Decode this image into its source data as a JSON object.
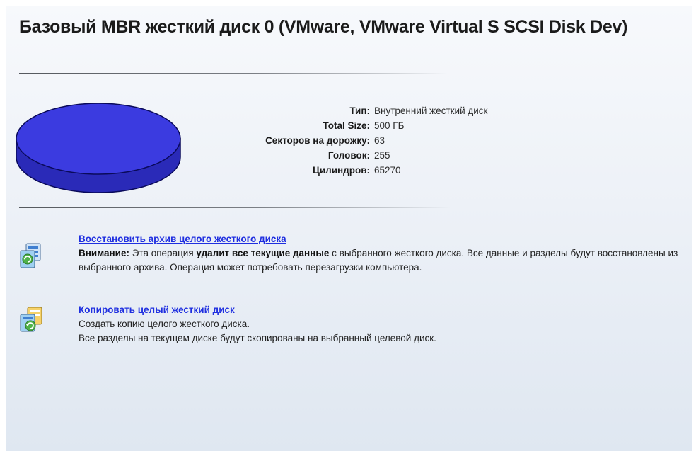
{
  "disk": {
    "title": "Базовый MBR жесткий диск 0 (VMware, VMware Virtual S SCSI Disk Dev)",
    "colors": {
      "disk_top": "#3b3be0",
      "disk_side": "#2a2ab8",
      "disk_outline": "#0a0a5a",
      "link": "#1f2fe0"
    },
    "properties": [
      {
        "label": "Тип:",
        "value": "Внутренний жесткий диск"
      },
      {
        "label": "Total Size:",
        "value": "500 ГБ"
      },
      {
        "label": "Секторов на дорожку:",
        "value": "63"
      },
      {
        "label": "Головок:",
        "value": "255"
      },
      {
        "label": "Цилиндров:",
        "value": "65270"
      }
    ]
  },
  "actions": {
    "restore": {
      "icon": "restore-disk-icon",
      "link": "Восстановить архив целого жесткого диска",
      "warning_label": "Внимание:",
      "text_1": " Эта операция ",
      "text_strong": "удалит все текущие данные",
      "text_2": " с выбранного жесткого диска. Все данные и разделы будут восстановлены из выбранного архива. Операция может потребовать перезагрузки компьютера."
    },
    "copy": {
      "icon": "copy-disk-icon",
      "link": "Копировать целый жесткий диск",
      "line_1": "Создать копию целого жесткого диска.",
      "line_2": "Все разделы на текущем диске будут скопированы на выбранный целевой диск."
    }
  }
}
